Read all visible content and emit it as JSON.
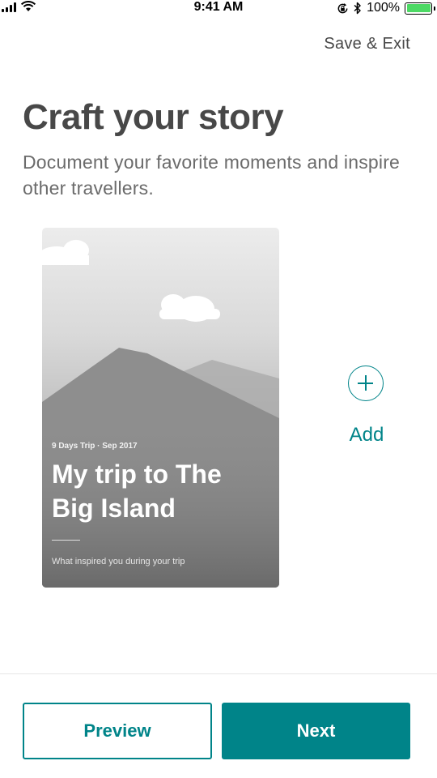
{
  "status_bar": {
    "time": "9:41 AM",
    "battery_text": "100%",
    "battery_level": 1.0
  },
  "header": {
    "save_exit": "Save & Exit"
  },
  "intro": {
    "title": "Craft your story",
    "subtitle": "Document your favorite moments and inspire other travellers."
  },
  "story_card": {
    "meta": "9 Days Trip · Sep 2017",
    "title": "My trip to The Big Island",
    "prompt": "What inspired you during your trip"
  },
  "add": {
    "label": "Add"
  },
  "footer": {
    "preview_label": "Preview",
    "next_label": "Next"
  },
  "colors": {
    "accent": "#008489",
    "text_primary": "#484848",
    "battery": "#4cd964"
  }
}
